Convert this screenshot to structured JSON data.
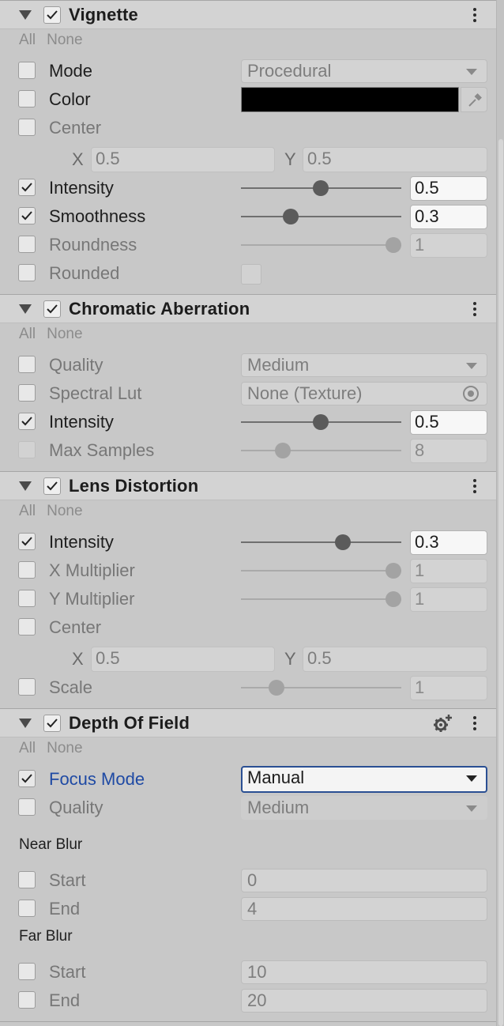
{
  "common": {
    "all": "All",
    "none": "None"
  },
  "vignette": {
    "title": "Vignette",
    "mode": {
      "label": "Mode",
      "value": "Procedural"
    },
    "color": {
      "label": "Color",
      "value": "#000000"
    },
    "center": {
      "label": "Center",
      "x_label": "X",
      "x": "0.5",
      "y_label": "Y",
      "y": "0.5"
    },
    "intensity": {
      "label": "Intensity",
      "value": "0.5",
      "fraction": 0.5
    },
    "smoothness": {
      "label": "Smoothness",
      "value": "0.3",
      "fraction": 0.3
    },
    "roundness": {
      "label": "Roundness",
      "value": "1",
      "fraction": 1.0
    },
    "rounded": {
      "label": "Rounded"
    }
  },
  "chromatic": {
    "title": "Chromatic Aberration",
    "quality": {
      "label": "Quality",
      "value": "Medium"
    },
    "spectral": {
      "label": "Spectral Lut",
      "value": "None (Texture)"
    },
    "intensity": {
      "label": "Intensity",
      "value": "0.5",
      "fraction": 0.5
    },
    "max_samples": {
      "label": "Max Samples",
      "value": "8"
    }
  },
  "lens": {
    "title": "Lens Distortion",
    "intensity": {
      "label": "Intensity",
      "value": "0.3"
    },
    "x_mult": {
      "label": "X Multiplier",
      "value": "1"
    },
    "y_mult": {
      "label": "Y Multiplier",
      "value": "1"
    },
    "center": {
      "label": "Center",
      "x_label": "X",
      "x": "0.5",
      "y_label": "Y",
      "y": "0.5"
    },
    "scale": {
      "label": "Scale",
      "value": "1"
    }
  },
  "dof": {
    "title": "Depth Of Field",
    "focus_mode": {
      "label": "Focus Mode",
      "value": "Manual"
    },
    "quality": {
      "label": "Quality",
      "value": "Medium"
    },
    "near_blur": "Near Blur",
    "near_start": {
      "label": "Start",
      "value": "0"
    },
    "near_end": {
      "label": "End",
      "value": "4"
    },
    "far_blur": "Far Blur",
    "far_start": {
      "label": "Start",
      "value": "10"
    },
    "far_end": {
      "label": "End",
      "value": "20"
    }
  }
}
